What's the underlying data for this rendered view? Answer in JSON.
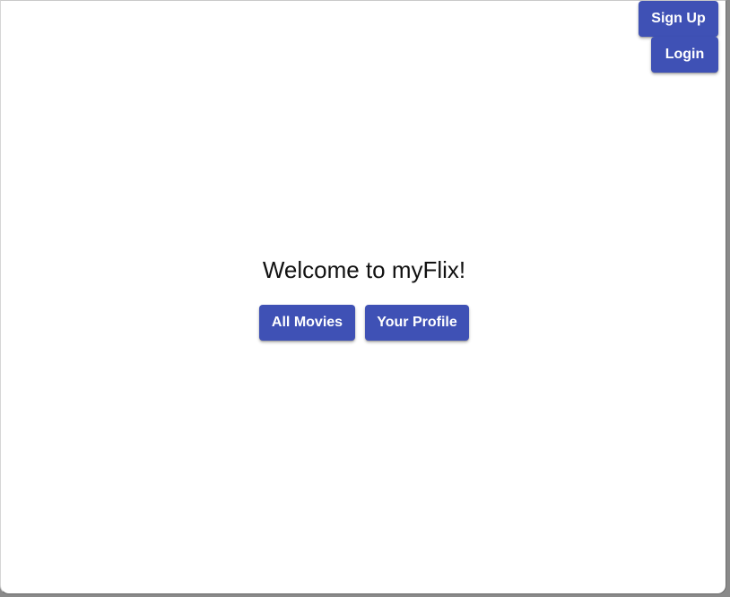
{
  "header": {
    "signup_label": "Sign Up",
    "login_label": "Login"
  },
  "main": {
    "title": "Welcome to myFlix!",
    "all_movies_label": "All Movies",
    "your_profile_label": "Your Profile"
  },
  "colors": {
    "accent": "#3f51b5",
    "background": "#ffffff"
  }
}
